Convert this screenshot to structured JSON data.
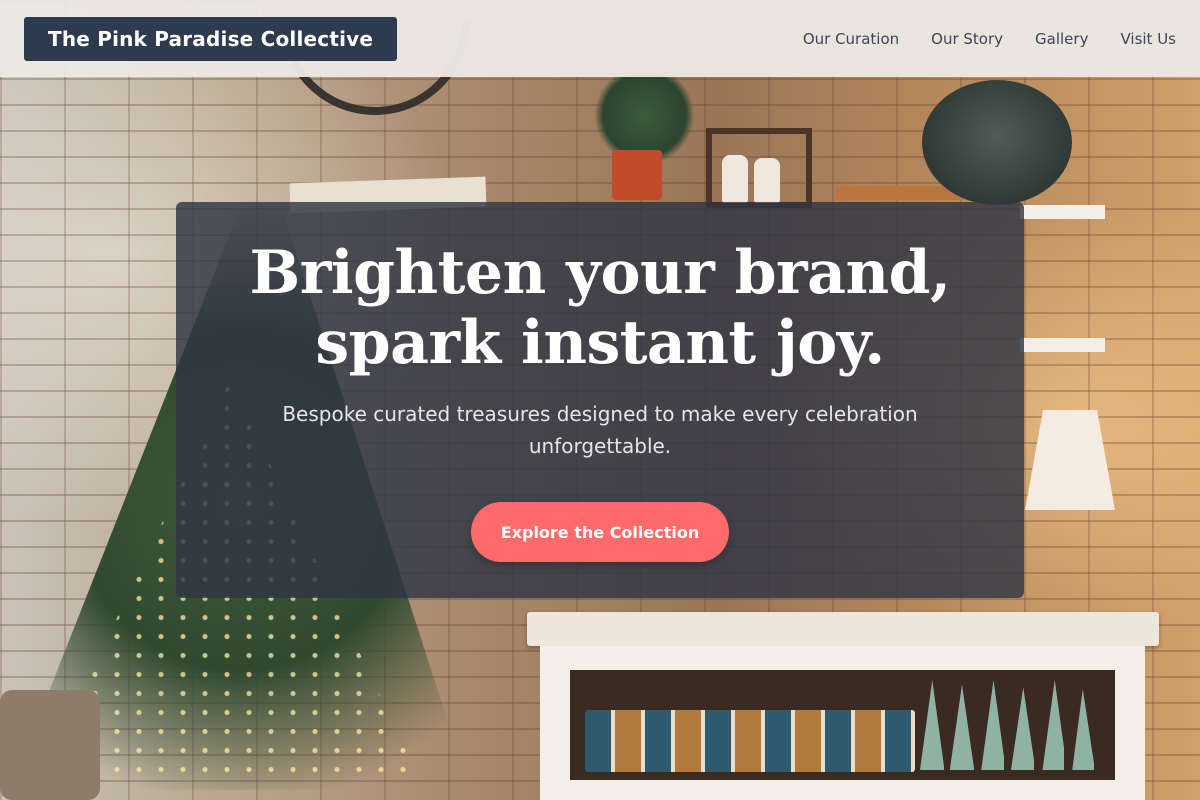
{
  "header": {
    "brand": "The Pink Paradise Collective",
    "nav": [
      {
        "label": "Our Curation"
      },
      {
        "label": "Our Story"
      },
      {
        "label": "Gallery"
      },
      {
        "label": "Visit Us"
      }
    ]
  },
  "hero": {
    "headline_line1": "Brighten your brand,",
    "headline_line2": "spark instant joy.",
    "subtitle": "Bespoke curated treasures designed to make every celebration unforgettable.",
    "cta_label": "Explore the Collection"
  },
  "colors": {
    "brand_bg": "#2e3b4e",
    "cta": "#ff6b6b",
    "card_overlay": "#303644"
  }
}
